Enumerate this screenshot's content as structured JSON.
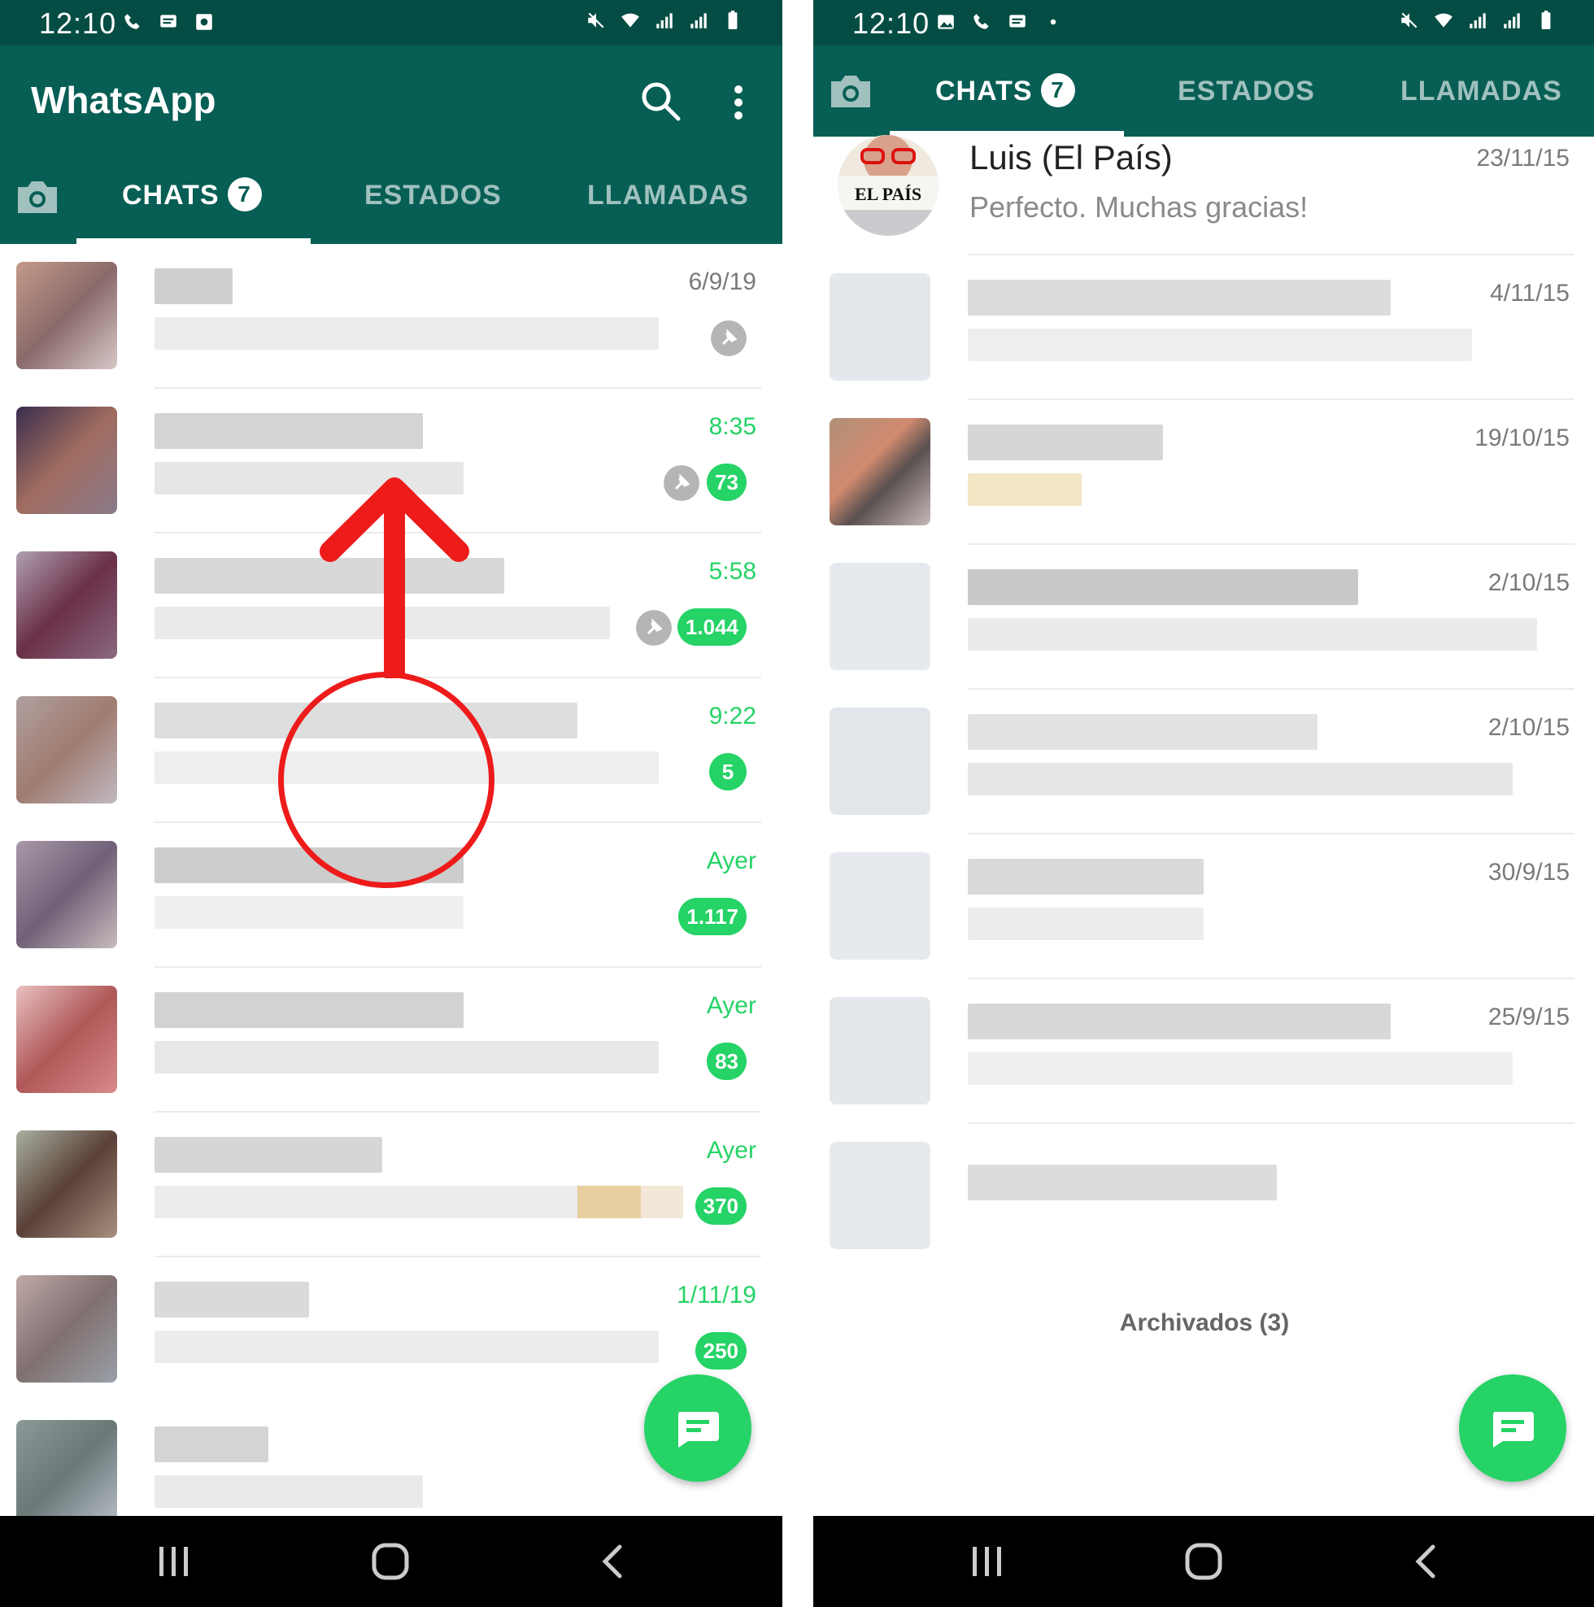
{
  "colors": {
    "header": "#075e54",
    "status_bar": "#054d44",
    "accent_green": "#25d366",
    "annotation_red": "#ee1b1b"
  },
  "left": {
    "status_time": "12:10",
    "app_title": "WhatsApp",
    "tabs": {
      "chats": "CHATS",
      "chats_badge": "7",
      "estados": "ESTADOS",
      "llamadas": "LLAMADAS"
    },
    "chats": [
      {
        "time": "6/9/19",
        "badge": "",
        "pinned": true
      },
      {
        "time": "8:35",
        "badge": "73",
        "pinned": true
      },
      {
        "time": "5:58",
        "badge": "1.044",
        "pinned": true
      },
      {
        "time": "9:22",
        "badge": "5",
        "pinned": false
      },
      {
        "time": "Ayer",
        "badge": "1.117",
        "pinned": false
      },
      {
        "time": "Ayer",
        "badge": "83",
        "pinned": false
      },
      {
        "time": "Ayer",
        "badge": "370",
        "pinned": false
      },
      {
        "time": "1/11/19",
        "badge": "250",
        "pinned": false
      }
    ],
    "icons": [
      "search-icon",
      "more-vert-icon",
      "camera-icon",
      "pin-icon",
      "new-chat-icon",
      "arrow-up-icon"
    ]
  },
  "right": {
    "status_time": "12:10",
    "tabs": {
      "chats": "CHATS",
      "chats_badge": "7",
      "estados": "ESTADOS",
      "llamadas": "LLAMADAS"
    },
    "featured": {
      "name": "Luis (El País)",
      "message": "Perfecto. Muchas gracias!",
      "time": "23/11/15",
      "avatar_text": "EL PAÍS"
    },
    "chats": [
      {
        "time": "4/11/15"
      },
      {
        "time": "19/10/15"
      },
      {
        "time": "2/10/15"
      },
      {
        "time": "2/10/15"
      },
      {
        "time": "30/9/15"
      },
      {
        "time": "25/9/15"
      },
      {
        "time": ""
      }
    ],
    "archived": "Archivados (3)"
  }
}
